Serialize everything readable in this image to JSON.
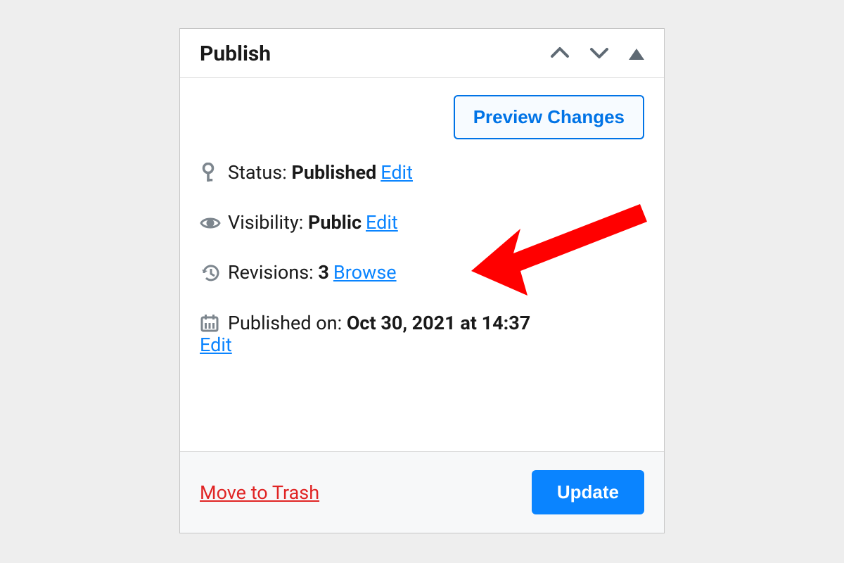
{
  "panel": {
    "title": "Publish",
    "preview_button": "Preview Changes",
    "status": {
      "label": "Status: ",
      "value": "Published",
      "edit": "Edit"
    },
    "visibility": {
      "label": "Visibility: ",
      "value": "Public",
      "edit": "Edit"
    },
    "revisions": {
      "label": "Revisions: ",
      "count": "3",
      "browse": "Browse"
    },
    "published_on": {
      "label": "Published on: ",
      "value": "Oct 30, 2021 at 14:37",
      "edit": "Edit"
    },
    "footer": {
      "trash": "Move to Trash",
      "update": "Update"
    }
  }
}
